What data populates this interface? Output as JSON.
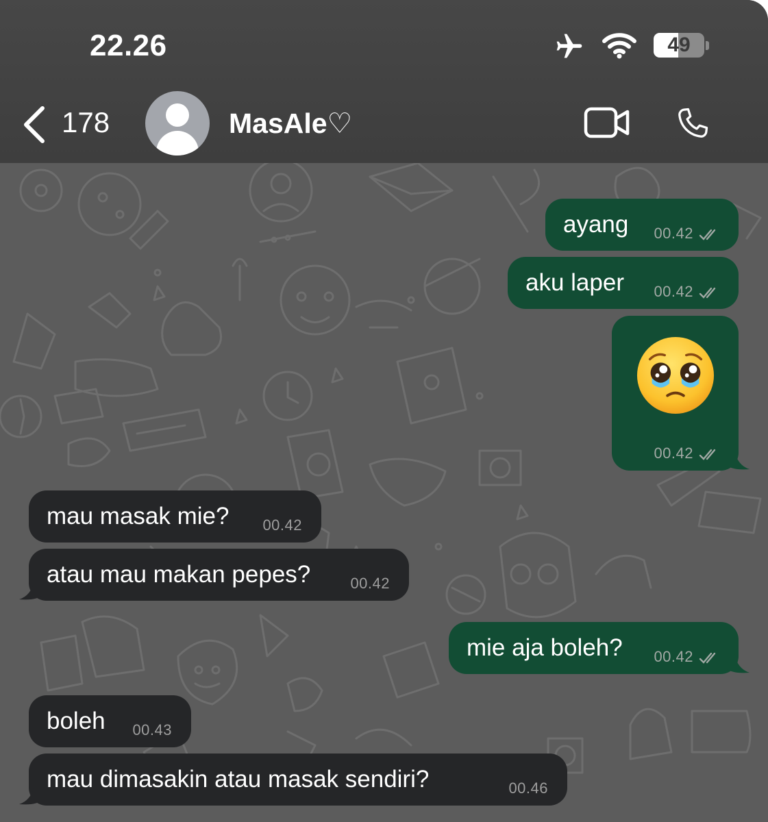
{
  "status_bar": {
    "time": "22.26",
    "battery_level": "49",
    "battery_fraction": 0.49,
    "icons": [
      "airplane-mode-icon",
      "wifi-icon",
      "battery-icon"
    ]
  },
  "header": {
    "back_count": "178",
    "contact_name": "MasAle♡",
    "actions": [
      "video-call-icon",
      "voice-call-icon"
    ]
  },
  "colors": {
    "outgoing_bubble": "#124d34",
    "incoming_bubble": "#252628",
    "chat_background": "#5c5c5c",
    "header_background": "#434343"
  },
  "messages": [
    {
      "direction": "out",
      "text": "ayang",
      "time": "00.42",
      "status": "read"
    },
    {
      "direction": "out",
      "text": "aku laper",
      "time": "00.42",
      "status": "read"
    },
    {
      "direction": "out",
      "emoji": "pleading-face",
      "time": "00.42",
      "status": "read"
    },
    {
      "direction": "in",
      "text": "mau masak mie?",
      "time": "00.42"
    },
    {
      "direction": "in",
      "text": "atau mau makan pepes?",
      "time": "00.42"
    },
    {
      "direction": "out",
      "text": "mie aja boleh?",
      "time": "00.42",
      "status": "read"
    },
    {
      "direction": "in",
      "text": "boleh",
      "time": "00.43"
    },
    {
      "direction": "in",
      "text": "mau dimasakin atau masak sendiri?",
      "time": "00.46"
    }
  ]
}
